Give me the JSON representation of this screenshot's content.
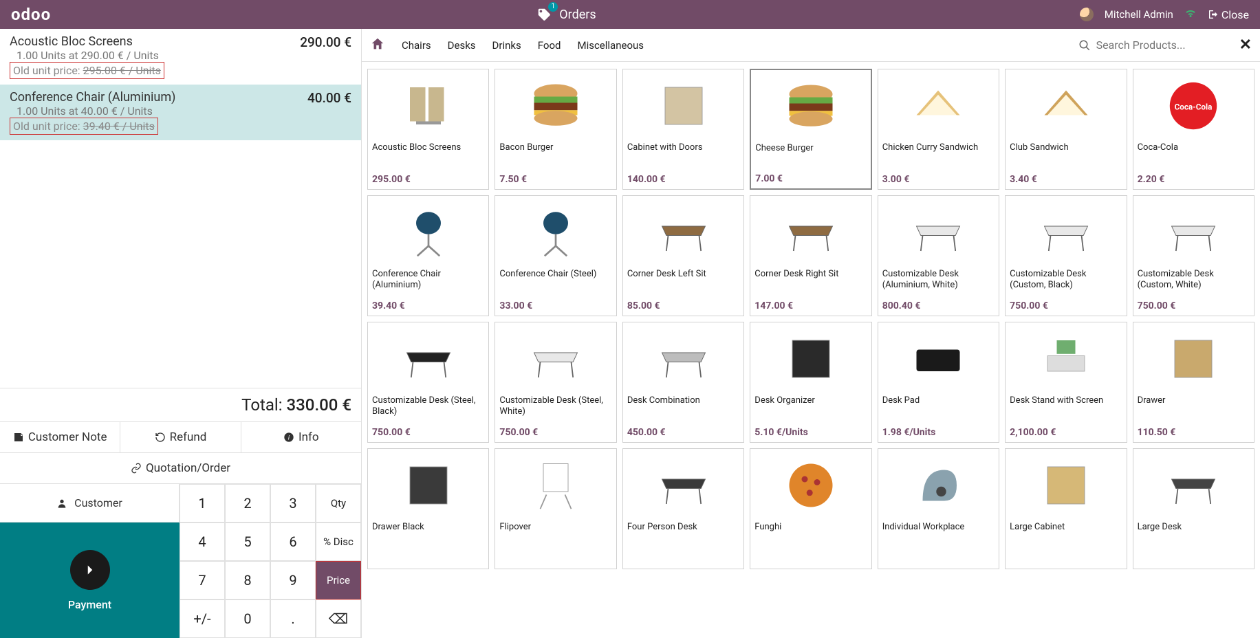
{
  "brand": "odoo",
  "header": {
    "ordersLabel": "Orders",
    "ordersBadge": "1",
    "user": "Mitchell Admin",
    "closeLabel": "Close"
  },
  "order": {
    "items": [
      {
        "name": "Acoustic Bloc Screens",
        "price": "290.00 €",
        "qtyLine": "1.00 Units at 290.00 € / Units",
        "oldLabel": "Old unit price: ",
        "oldValue": "295.00 € / Units",
        "selected": false
      },
      {
        "name": "Conference Chair (Aluminium)",
        "price": "40.00 €",
        "qtyLine": "1.00 Units at 40.00 € / Units",
        "oldLabel": "Old unit price: ",
        "oldValue": "39.40 € / Units",
        "selected": true
      }
    ],
    "totalLabel": "Total: ",
    "totalValue": "330.00 €"
  },
  "actions": {
    "customerNote": "Customer Note",
    "refund": "Refund",
    "info": "Info",
    "quotation": "Quotation/Order",
    "customer": "Customer",
    "payment": "Payment"
  },
  "keypad": {
    "k1": "1",
    "k2": "2",
    "k3": "3",
    "qty": "Qty",
    "k4": "4",
    "k5": "5",
    "k6": "6",
    "disc": "% Disc",
    "k7": "7",
    "k8": "8",
    "k9": "9",
    "price": "Price",
    "pm": "+/-",
    "k0": "0",
    "dot": ".",
    "back": "⌫"
  },
  "categories": [
    "Chairs",
    "Desks",
    "Drinks",
    "Food",
    "Miscellaneous"
  ],
  "search": {
    "placeholder": "Search Products..."
  },
  "products": [
    {
      "name": "Acoustic Bloc Screens",
      "price": "295.00 €",
      "shape": "screen",
      "c": "#c8b78e"
    },
    {
      "name": "Bacon Burger",
      "price": "7.50 €",
      "shape": "burger",
      "c": "#c99246"
    },
    {
      "name": "Cabinet with Doors",
      "price": "140.00 €",
      "shape": "box",
      "c": "#d3c4a3"
    },
    {
      "name": "Cheese Burger",
      "price": "7.00 €",
      "shape": "burger",
      "c": "#c77a2c",
      "sel": true
    },
    {
      "name": "Chicken Curry Sandwich",
      "price": "3.00 €",
      "shape": "sandwich",
      "c": "#e6c27a"
    },
    {
      "name": "Club Sandwich",
      "price": "3.40 €",
      "shape": "sandwich",
      "c": "#cfa35b"
    },
    {
      "name": "Coca-Cola",
      "price": "2.20 €",
      "shape": "circle",
      "c": "#e31e24"
    },
    {
      "name": "Conference Chair (Aluminium)",
      "price": "39.40 €",
      "shape": "chair",
      "c": "#1f4e6b"
    },
    {
      "name": "Conference Chair (Steel)",
      "price": "33.00 €",
      "shape": "chair",
      "c": "#1f4e6b"
    },
    {
      "name": "Corner Desk Left Sit",
      "price": "85.00 €",
      "shape": "desk",
      "c": "#8e6b42"
    },
    {
      "name": "Corner Desk Right Sit",
      "price": "147.00 €",
      "shape": "desk",
      "c": "#8e6b42"
    },
    {
      "name": "Customizable Desk (Aluminium, White)",
      "price": "800.40 €",
      "shape": "desk",
      "c": "#e8e8e8"
    },
    {
      "name": "Customizable Desk (Custom, Black)",
      "price": "750.00 €",
      "shape": "desk",
      "c": "#e8e8e8"
    },
    {
      "name": "Customizable Desk (Custom, White)",
      "price": "750.00 €",
      "shape": "desk",
      "c": "#e8e8e8"
    },
    {
      "name": "Customizable Desk (Steel, Black)",
      "price": "750.00 €",
      "shape": "desk",
      "c": "#222"
    },
    {
      "name": "Customizable Desk (Steel, White)",
      "price": "750.00 €",
      "shape": "desk",
      "c": "#e8e8e8"
    },
    {
      "name": "Desk Combination",
      "price": "450.00 €",
      "shape": "desk",
      "c": "#bdbdbd"
    },
    {
      "name": "Desk Organizer",
      "price": "5.10 €/Units",
      "shape": "box",
      "c": "#2a2a2a"
    },
    {
      "name": "Desk Pad",
      "price": "1.98 €/Units",
      "shape": "rect",
      "c": "#1a1a1a"
    },
    {
      "name": "Desk Stand with Screen",
      "price": "2,100.00 €",
      "shape": "monitor",
      "c": "#6fae6f"
    },
    {
      "name": "Drawer",
      "price": "110.50 €",
      "shape": "box",
      "c": "#c9a96d"
    },
    {
      "name": "Drawer Black",
      "price": "",
      "shape": "box",
      "c": "#3a3a3a"
    },
    {
      "name": "Flipover",
      "price": "",
      "shape": "board",
      "c": "#e8e8e8"
    },
    {
      "name": "Four Person Desk",
      "price": "",
      "shape": "desk",
      "c": "#3a3a3a"
    },
    {
      "name": "Funghi",
      "price": "",
      "shape": "pizza",
      "c": "#e0852a"
    },
    {
      "name": "Individual Workplace",
      "price": "",
      "shape": "pod",
      "c": "#8aa2ae"
    },
    {
      "name": "Large Cabinet",
      "price": "",
      "shape": "box",
      "c": "#d6b877"
    },
    {
      "name": "Large Desk",
      "price": "",
      "shape": "desk",
      "c": "#444"
    }
  ]
}
